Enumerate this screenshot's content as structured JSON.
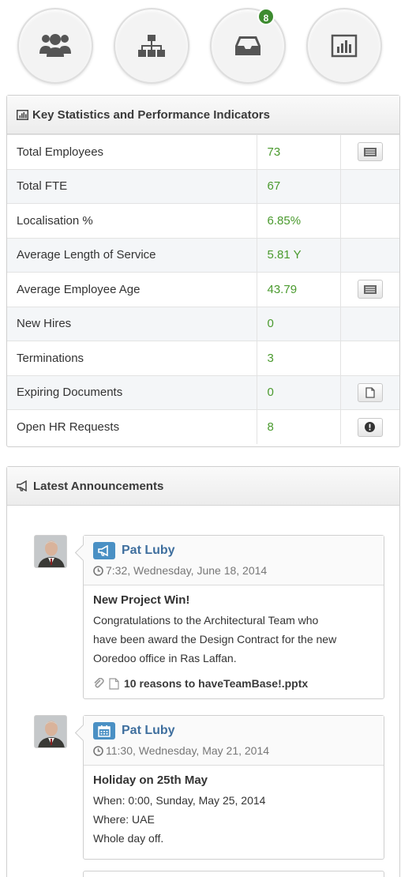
{
  "nav": {
    "items": [
      {
        "name": "people"
      },
      {
        "name": "org-chart"
      },
      {
        "name": "inbox",
        "badge": "8"
      },
      {
        "name": "reports"
      }
    ]
  },
  "stats": {
    "title": "Key Statistics and Performance Indicators",
    "rows": [
      {
        "label": "Total Employees",
        "value": "73",
        "action": "list-icon"
      },
      {
        "label": "Total FTE",
        "value": "67",
        "action": ""
      },
      {
        "label": "Localisation %",
        "value": "6.85%",
        "action": ""
      },
      {
        "label": "Average Length of Service",
        "value": "5.81 Y",
        "action": ""
      },
      {
        "label": "Average Employee Age",
        "value": "43.79",
        "action": "list-icon"
      },
      {
        "label": "New Hires",
        "value": "0",
        "action": ""
      },
      {
        "label": "Terminations",
        "value": "3",
        "action": ""
      },
      {
        "label": "Expiring Documents",
        "value": "0",
        "action": "document-icon"
      },
      {
        "label": "Open HR Requests",
        "value": "8",
        "action": "exclamation-icon"
      }
    ]
  },
  "announcements": {
    "title": "Latest Announcements",
    "items": [
      {
        "author": "Pat Luby",
        "time": "7:32, Wednesday, June 18, 2014",
        "type_icon": "megaphone-icon",
        "title": "New Project Win!",
        "lines": [
          "Congratulations to the Architectural Team who",
          "have been award the Design Contract for the new",
          "Ooredoo office in Ras Laffan."
        ],
        "attachment": "10 reasons to haveTeamBase!.pptx"
      },
      {
        "author": "Pat Luby",
        "time": "11:30, Wednesday, May 21, 2014",
        "type_icon": "calendar-icon",
        "title": "Holiday on 25th May",
        "lines": [
          "When: 0:00, Sunday, May 25, 2014",
          "Where: UAE",
          "Whole day off."
        ]
      }
    ]
  },
  "colors": {
    "accent_green": "#4a9a2e",
    "badge_green": "#3d8b2f",
    "author_blue": "#3f6f9e",
    "type_icon_blue": "#4a90c4"
  }
}
